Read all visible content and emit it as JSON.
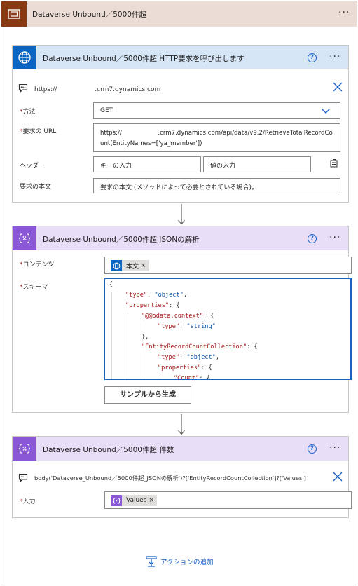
{
  "scope": {
    "title": "Dataverse Unbound／5000件超",
    "icon": "scope-icon",
    "more": "···"
  },
  "http": {
    "title": "Dataverse Unbound／5000件超 HTTP要求を呼び出します",
    "accent": "#0a65c2",
    "help": "?",
    "more": "···",
    "connection": "https://　　　　　　.crm7.dynamics.com",
    "method_label": "方法",
    "method_value": "GET",
    "url_label": "要求の URL",
    "url_line1": "https://　　　　　　.crm7.dynamics.com/api/data/v9.2/RetrieveTotalRecordCo",
    "url_line2": "unt(EntityNames=['ya_member'])",
    "headers_label": "ヘッダー",
    "header_key_placeholder": "キーの入力",
    "header_value_placeholder": "値の入力",
    "body_label": "要求の本文",
    "body_placeholder": "要求の本文 (メソッドによって必要とされている場合)。",
    "required_mark": "*"
  },
  "json": {
    "title": "Dataverse Unbound／5000件超 JSONの解析",
    "accent": "#8a58d6",
    "help": "?",
    "more": "···",
    "content_label": "コンテンツ",
    "content_token": "本文",
    "schema_label": "スキーマ",
    "schema_lines": [
      {
        "indent": 0,
        "text": "{"
      },
      {
        "indent": 1,
        "key": "\"type\"",
        "value": "\"object\"",
        "tail": ","
      },
      {
        "indent": 1,
        "key": "\"properties\"",
        "tail": " {"
      },
      {
        "indent": 2,
        "key": "\"@@odata.context\"",
        "tail": " {"
      },
      {
        "indent": 3,
        "key": "\"type\"",
        "value": "\"string\""
      },
      {
        "indent": 2,
        "text": "},"
      },
      {
        "indent": 2,
        "key": "\"EntityRecordCountCollection\"",
        "tail": " {"
      },
      {
        "indent": 3,
        "key": "\"type\"",
        "value": "\"object\"",
        "tail": ","
      },
      {
        "indent": 3,
        "key": "\"properties\"",
        "tail": " {"
      },
      {
        "indent": 4,
        "key": "\"Count\"",
        "tail": " {"
      }
    ],
    "sample_button": "サンプルから生成",
    "required_mark": "*"
  },
  "count": {
    "title": "Dataverse Unbound／5000件超 件数",
    "accent": "#8a58d6",
    "help": "?",
    "more": "···",
    "expression": "body('Dataverse_Unbound／5000件超_JSONの解析')?['EntityRecordCountCollection']?['Values']",
    "input_label": "入力",
    "input_token": "Values",
    "required_mark": "*"
  },
  "footer": {
    "add_action": "アクションの追加"
  }
}
